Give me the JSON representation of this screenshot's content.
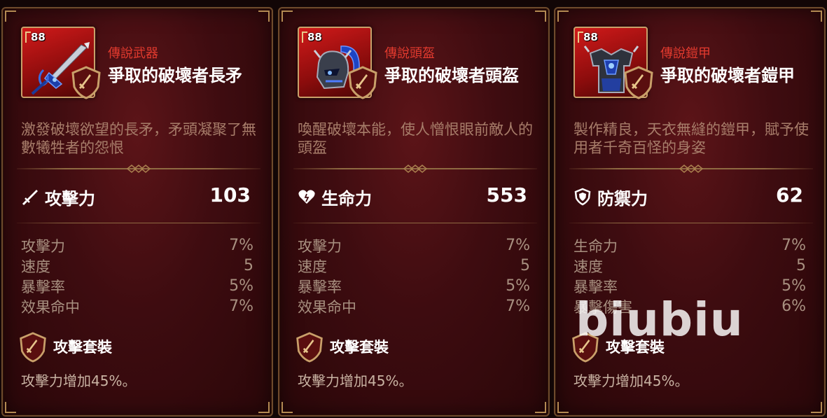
{
  "cards": [
    {
      "level": "88",
      "rarity": "傳說武器",
      "name": "爭取的破壞者長矛",
      "description": "激發破壞欲望的長矛，矛頭凝聚了無數犧牲者的怨恨",
      "main_stat": {
        "icon": "sword-icon",
        "label": "攻擊力",
        "value": "103"
      },
      "substats": [
        {
          "label": "攻擊力",
          "value": "7%"
        },
        {
          "label": "速度",
          "value": "5"
        },
        {
          "label": "暴擊率",
          "value": "5%"
        },
        {
          "label": "效果命中",
          "value": "7%"
        }
      ],
      "set": {
        "icon": "attack-set-shield-icon",
        "name": "攻擊套裝",
        "effect": "攻擊力增加45%。"
      }
    },
    {
      "level": "88",
      "rarity": "傳說頭盔",
      "name": "爭取的破壞者頭盔",
      "description": "喚醒破壞本能，使人憎恨眼前敵人的頭盔",
      "main_stat": {
        "icon": "heart-icon",
        "label": "生命力",
        "value": "553"
      },
      "substats": [
        {
          "label": "攻擊力",
          "value": "7%"
        },
        {
          "label": "速度",
          "value": "5"
        },
        {
          "label": "暴擊率",
          "value": "5%"
        },
        {
          "label": "效果命中",
          "value": "7%"
        }
      ],
      "set": {
        "icon": "attack-set-shield-icon",
        "name": "攻擊套裝",
        "effect": "攻擊力增加45%。"
      }
    },
    {
      "level": "88",
      "rarity": "傳說鎧甲",
      "name": "爭取的破壞者鎧甲",
      "description": "製作精良，天衣無縫的鎧甲，賦予使用者千奇百怪的身姿",
      "main_stat": {
        "icon": "shield-icon",
        "label": "防禦力",
        "value": "62"
      },
      "substats": [
        {
          "label": "生命力",
          "value": "7%"
        },
        {
          "label": "速度",
          "value": "5"
        },
        {
          "label": "暴擊率",
          "value": "5%"
        },
        {
          "label": "暴擊傷害",
          "value": "6%"
        }
      ],
      "set": {
        "icon": "attack-set-shield-icon",
        "name": "攻擊套裝",
        "effect": "攻擊力增加45%。"
      }
    }
  ],
  "watermark": "biubiu",
  "colors": {
    "card_bg": "#3e0c10",
    "rarity_red": "#e23a2e",
    "border_gold": "#b38a52",
    "item_bg": "#d11a1a"
  }
}
